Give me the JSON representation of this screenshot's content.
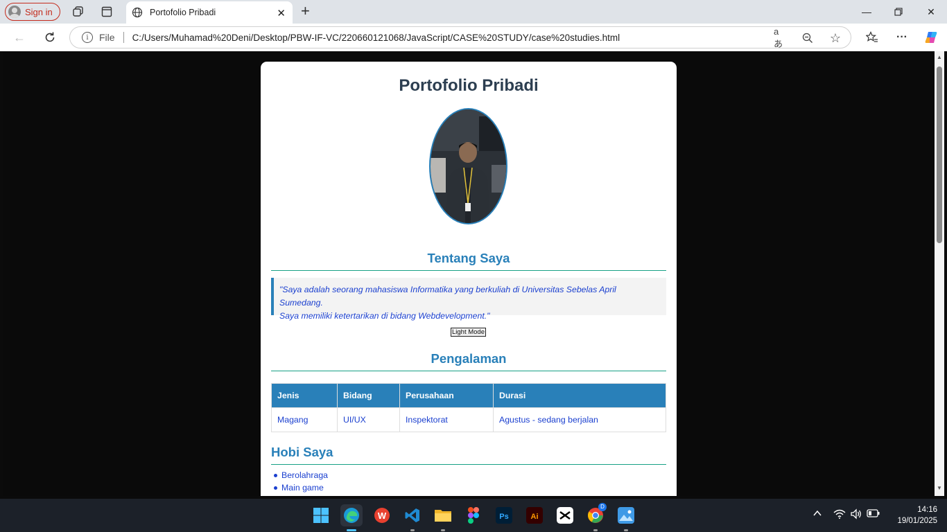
{
  "browser": {
    "signin_label": "Sign in",
    "tab_title": "Portofolio Pribadi",
    "url_scheme_label": "File",
    "url": "C:/Users/Muhamad%20Deni/Desktop/PBW-IF-VC/220660121068/JavaScript/CASE%20STUDY/case%20studies.html"
  },
  "page": {
    "title": "Portofolio Pribadi",
    "about": {
      "heading": "Tentang Saya",
      "quote_line1": "\"Saya adalah seorang mahasiswa Informatika yang berkuliah di Universitas Sebelas April Sumedang.",
      "quote_line2": "Saya memiliki ketertarikan di bidang Webdevelopment.\""
    },
    "mode_button": "Light Mode",
    "experience": {
      "heading": "Pengalaman",
      "columns": [
        "Jenis",
        "Bidang",
        "Perusahaan",
        "Durasi"
      ],
      "rows": [
        [
          "Magang",
          "UI/UX",
          "Inspektorat",
          "Agustus - sedang berjalan"
        ]
      ]
    },
    "hobbies": {
      "heading": "Hobi Saya",
      "items": [
        "Berolahraga",
        "Main game"
      ]
    }
  },
  "taskbar": {
    "time": "14:16",
    "date": "19/01/2025",
    "apps": [
      "start-icon",
      "edge-icon",
      "wps-icon",
      "vscode-icon",
      "file-explorer-icon",
      "figma-icon",
      "photoshop-icon",
      "illustrator-icon",
      "capcut-icon",
      "chrome-icon",
      "photos-icon"
    ]
  },
  "colors": {
    "accent": "#2980b9",
    "heading_dark": "#2c3e50",
    "link_text": "#1a3fcf",
    "divider": "#16a085"
  }
}
